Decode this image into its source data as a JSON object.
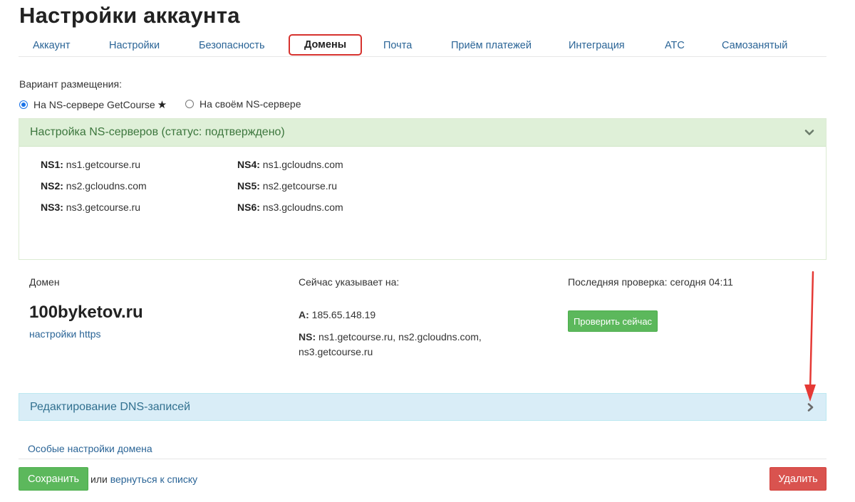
{
  "page_title": "Настройки аккаунта",
  "tabs": [
    {
      "label": "Аккаунт",
      "active": false
    },
    {
      "label": "Настройки",
      "active": false
    },
    {
      "label": "Безопасность",
      "active": false
    },
    {
      "label": "Домены",
      "active": true
    },
    {
      "label": "Почта",
      "active": false
    },
    {
      "label": "Приём платежей",
      "active": false
    },
    {
      "label": "Интеграция",
      "active": false
    },
    {
      "label": "АТС",
      "active": false
    },
    {
      "label": "Самозанятый",
      "active": false
    }
  ],
  "placement": {
    "label": "Вариант размещения:",
    "options": [
      {
        "label": "На NS-сервере GetCourse",
        "selected": true,
        "star": "★"
      },
      {
        "label": "На своём NS-сервере",
        "selected": false
      }
    ]
  },
  "ns_panel": {
    "title": "Настройка NS-серверов (статус: подтверждено)",
    "servers": [
      {
        "key": "NS1:",
        "value": "ns1.getcourse.ru"
      },
      {
        "key": "NS2:",
        "value": "ns2.gcloudns.com"
      },
      {
        "key": "NS3:",
        "value": "ns3.getcourse.ru"
      },
      {
        "key": "NS4:",
        "value": "ns1.gcloudns.com"
      },
      {
        "key": "NS5:",
        "value": "ns2.getcourse.ru"
      },
      {
        "key": "NS6:",
        "value": "ns3.gcloudns.com"
      }
    ]
  },
  "domain": {
    "label": "Домен",
    "name": "100byketov.ru",
    "https_link": "настройки https",
    "points_label": "Сейчас указывает на:",
    "a_key": "A:",
    "a_value": "185.65.148.19",
    "ns_key": "NS:",
    "ns_value": "ns1.getcourse.ru, ns2.gcloudns.com,",
    "ns_value_2": "ns3.getcourse.ru",
    "last_check": "Последняя проверка: сегодня 04:11",
    "check_button": "Проверить сейчас"
  },
  "dns_panel": {
    "title": "Редактирование DNS-записей"
  },
  "special_settings_link": "Особые настройки домена",
  "footer": {
    "save_button": "Сохранить",
    "or_text": "или",
    "back_link": "вернуться к списку",
    "delete_button": "Удалить"
  },
  "colors": {
    "accent_link": "#2a6496",
    "success": "#5cb85c",
    "danger": "#d9534f",
    "annotation": "#e53935"
  },
  "icons": {
    "ns_panel": "chevron-down-icon",
    "dns_panel": "chevron-right-icon",
    "annotation": "red-arrow-icon"
  }
}
